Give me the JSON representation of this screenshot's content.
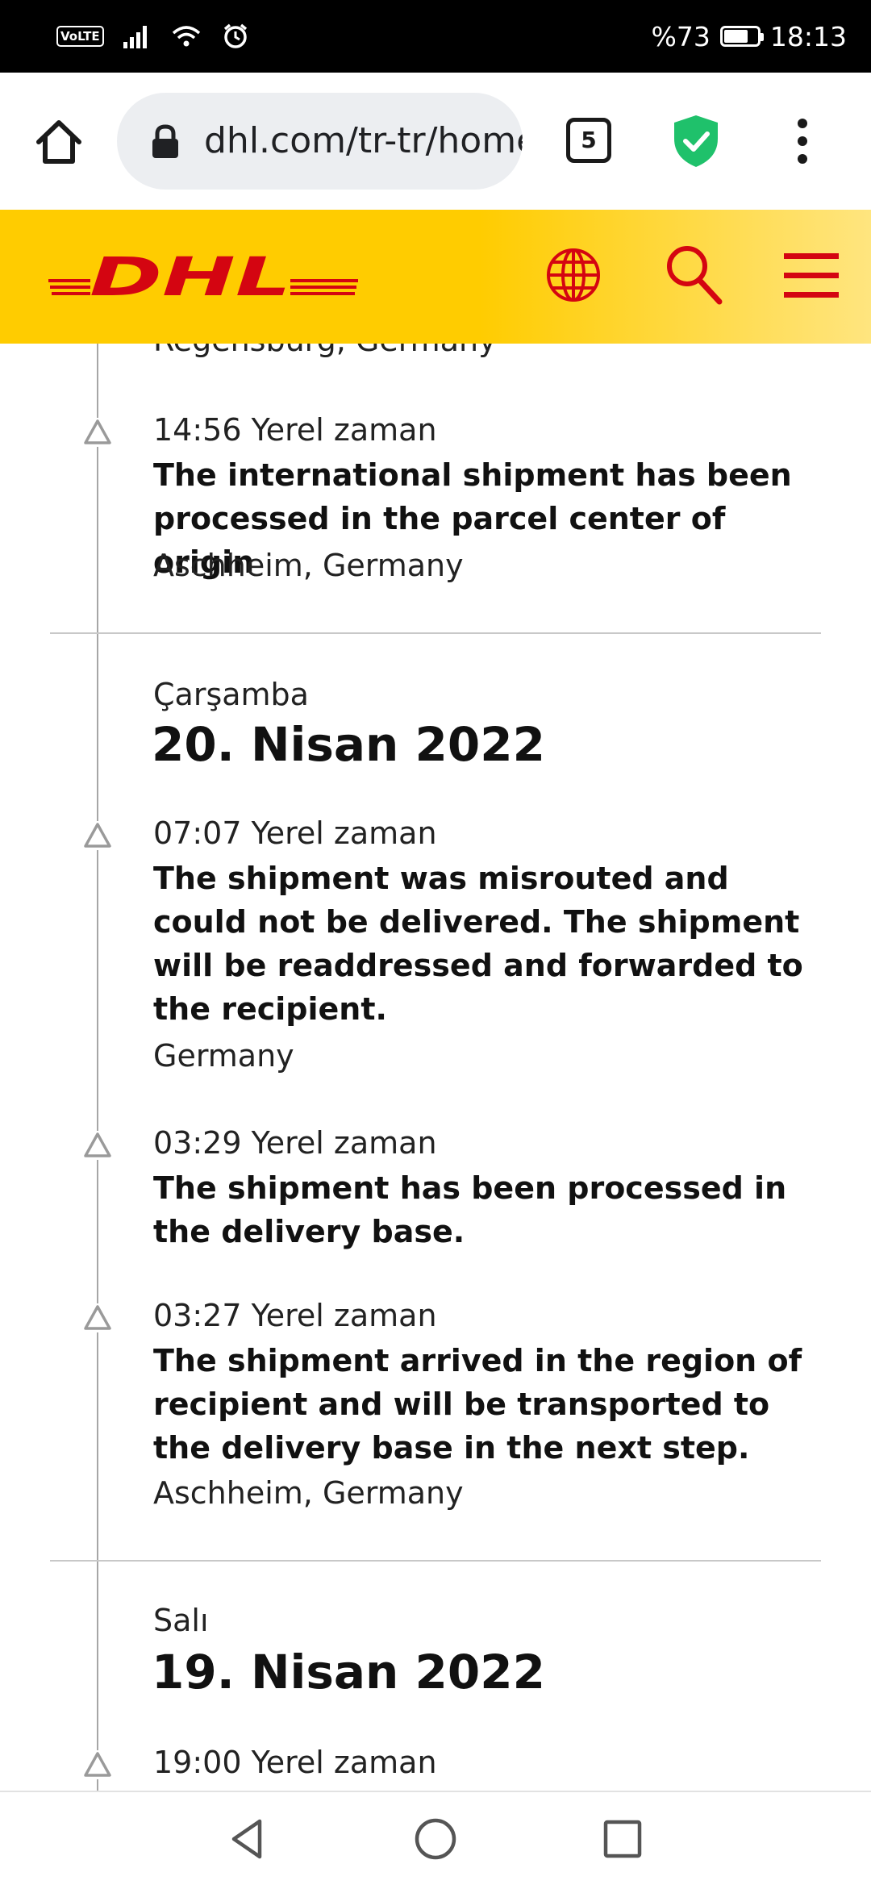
{
  "status_bar": {
    "volte": "VoLTE",
    "battery_text": "%73",
    "battery_level": 0.73,
    "time": "18:13",
    "icons": [
      "signal-icon",
      "wifi-icon",
      "alarm-icon",
      "battery-icon"
    ]
  },
  "browser": {
    "url": "dhl.com/tr-tr/home",
    "tab_count": "5",
    "icons": [
      "home-icon",
      "lock-icon",
      "shield-check-icon",
      "more-vert-icon"
    ],
    "shield_color": "#1fc16b"
  },
  "header": {
    "logo_text": "DHL",
    "brand_yellow": "#ffcc00",
    "brand_red": "#d40511",
    "icons": [
      "globe-icon",
      "search-icon",
      "menu-icon"
    ]
  },
  "timeline": {
    "partial_location": "Regensburg, Germany",
    "events_top": [
      {
        "time": "14:56 Yerel zaman",
        "description": "The international shipment has been processed in the parcel center of origin",
        "location": "Aschheim, Germany"
      }
    ],
    "days": [
      {
        "day_name": "Çarşamba",
        "date": "20. Nisan 2022",
        "events": [
          {
            "time": "07:07 Yerel zaman",
            "description": "The shipment was misrouted and could not be delivered. The shipment will be readdressed and forwarded to the recipient.",
            "location": "Germany"
          },
          {
            "time": "03:29 Yerel zaman",
            "description": "The shipment has been processed in the delivery base.",
            "location": ""
          },
          {
            "time": "03:27 Yerel zaman",
            "description": "The shipment arrived in the region of recipient and will be transported to the delivery base in the next step.",
            "location": "Aschheim, Germany"
          }
        ]
      },
      {
        "day_name": "Salı",
        "date": "19. Nisan 2022",
        "events": [
          {
            "time": "19:00 Yerel zaman",
            "description": "",
            "location": ""
          }
        ]
      }
    ]
  },
  "nav_bar": {
    "icons": [
      "back-icon",
      "home-circle-icon",
      "recents-icon"
    ]
  }
}
